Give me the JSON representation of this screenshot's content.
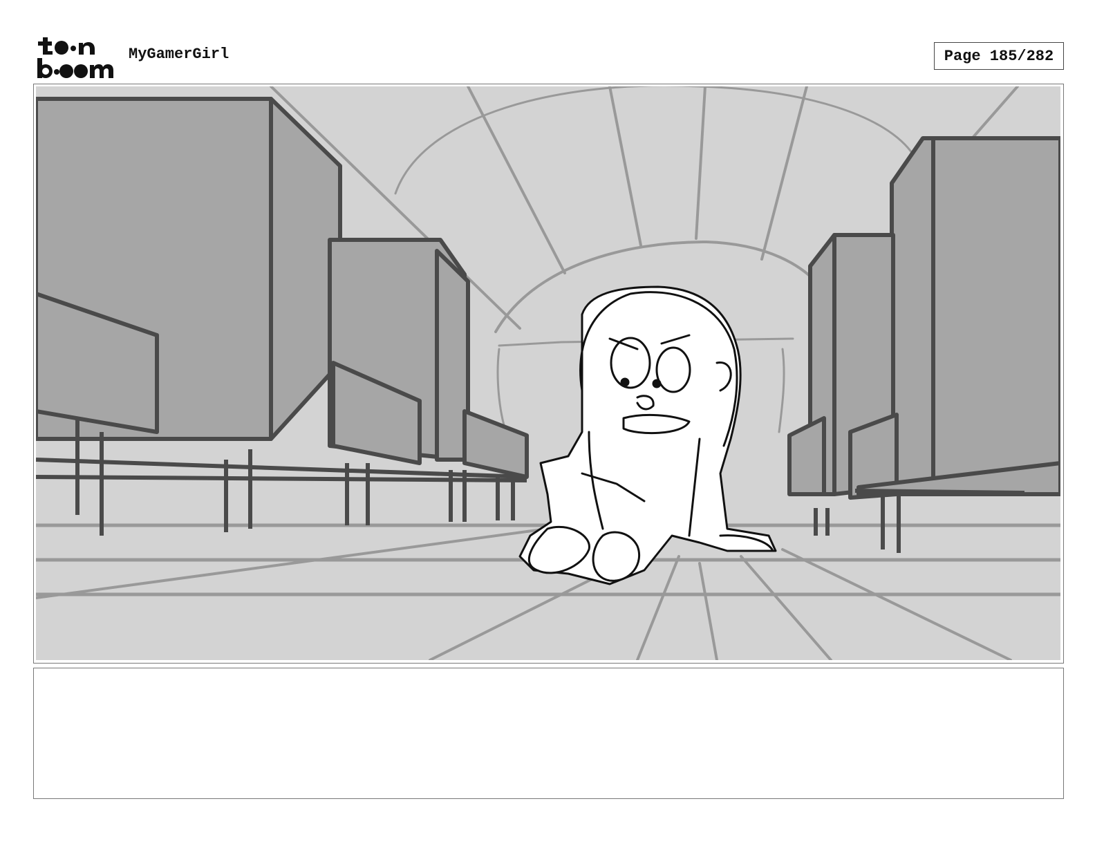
{
  "header": {
    "logo_name": "toon-boom-logo",
    "project_title": "MyGamerGirl",
    "page_counter": "Page 185/282"
  },
  "panel": {
    "image_description_name": "storyboard-panel-sketch"
  },
  "caption": {
    "text": ""
  },
  "colors": {
    "background_light": "#d3d3d3",
    "buildings": "#a6a6a6",
    "lines_dark": "#4a4a4a",
    "lines_mid": "#999999",
    "character_fill": "#ffffff",
    "ink": "#111111"
  }
}
